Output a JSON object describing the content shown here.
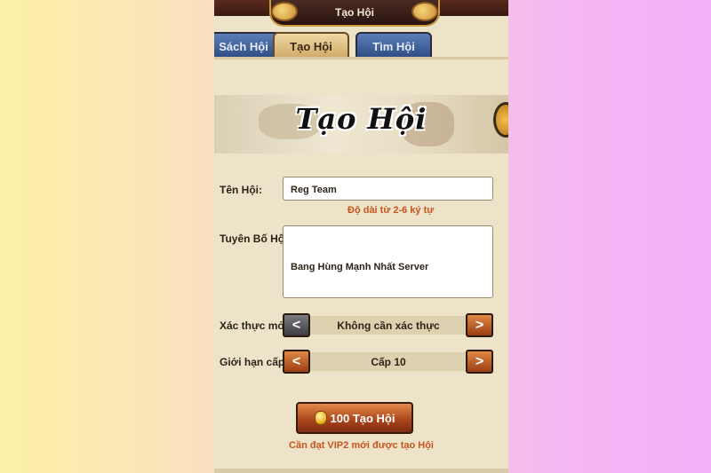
{
  "header": {
    "title": "Tạo Hội"
  },
  "tabs": [
    {
      "label": "Sách Hội"
    },
    {
      "label": "Tạo Hội"
    },
    {
      "label": "Tìm Hội"
    }
  ],
  "banner": {
    "title": "Tạo Hội"
  },
  "form": {
    "name_label": "Tên Hội:",
    "name_value": "Reg Team",
    "name_hint": "Độ dài từ 2-6 ký tự",
    "declaration_label": "Tuyên Bố Hội:",
    "declaration_value": "Bang Hùng Mạnh Nhất Server",
    "verify_label": "Xác thực mở:",
    "verify_value": "Không cần xác thực",
    "level_label": "Giới hạn cấp:",
    "level_value": "Cấp 10",
    "prev_symbol": "<",
    "next_symbol": ">"
  },
  "create": {
    "button_label": "100 Tạo Hội",
    "vip_note": "Cần đạt VIP2 mới được tạo Hội"
  },
  "colors": {
    "accent_orange": "#c8541c",
    "tab_blue": "#2c4a82",
    "panel_bg": "#ece3c9"
  }
}
